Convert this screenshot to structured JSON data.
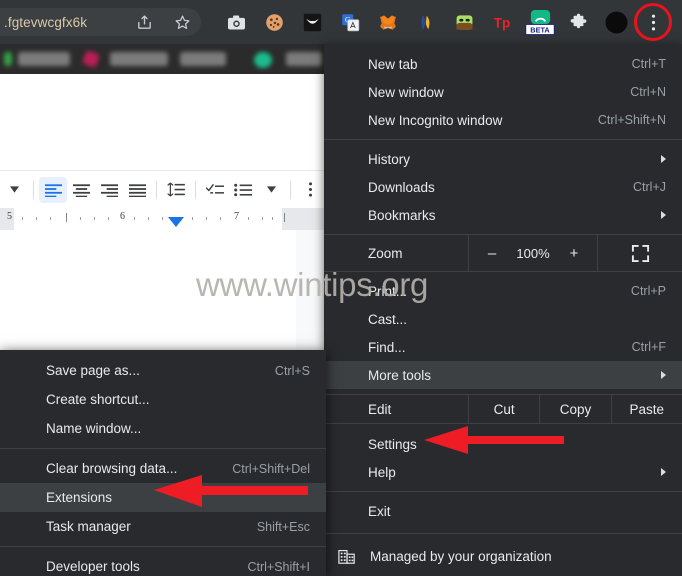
{
  "browser": {
    "omnibox_value": ".fgtevwcgfx6k",
    "toolbar_icons": [
      {
        "name": "share-icon"
      },
      {
        "name": "bookmark-star-icon"
      },
      {
        "name": "screenshot-camera-icon"
      },
      {
        "name": "cookie-icon"
      },
      {
        "name": "owl-extension-icon"
      },
      {
        "name": "google-translate-icon"
      },
      {
        "name": "metamask-fox-icon"
      },
      {
        "name": "sandbox-extension-icon"
      },
      {
        "name": "green-extension-icon"
      },
      {
        "name": "tp-extension-icon"
      },
      {
        "name": "beta-extension-icon"
      },
      {
        "name": "puzzle-extensions-icon"
      },
      {
        "name": "profile-avatar-icon"
      },
      {
        "name": "three-dot-menu-icon"
      }
    ]
  },
  "docs": {
    "toolbar_buttons": [
      {
        "name": "dropdown-caret"
      },
      {
        "name": "align-left-icon"
      },
      {
        "name": "align-center-icon"
      },
      {
        "name": "align-right-icon"
      },
      {
        "name": "align-justify-icon"
      },
      {
        "name": "line-spacing-icon"
      },
      {
        "name": "checklist-icon"
      },
      {
        "name": "bulleted-list-icon"
      },
      {
        "name": "list-dropdown-caret"
      },
      {
        "name": "more-options-icon"
      }
    ],
    "ruler_marks": [
      "5",
      "6",
      "7"
    ]
  },
  "watermark": "www.wintips.org",
  "menu": {
    "items_top": [
      {
        "label": "New tab",
        "accel": "Ctrl+T",
        "submenu": false
      },
      {
        "label": "New window",
        "accel": "Ctrl+N",
        "submenu": false
      },
      {
        "label": "New Incognito window",
        "accel": "Ctrl+Shift+N",
        "submenu": false
      }
    ],
    "items_nav": [
      {
        "label": "History",
        "accel": "",
        "submenu": true
      },
      {
        "label": "Downloads",
        "accel": "Ctrl+J",
        "submenu": false
      },
      {
        "label": "Bookmarks",
        "accel": "",
        "submenu": true
      }
    ],
    "zoom": {
      "label": "Zoom",
      "minus": "–",
      "value": "100%",
      "plus": "+",
      "fullscreen_icon": "fullscreen-icon"
    },
    "items_mid": [
      {
        "label": "Print...",
        "accel": "Ctrl+P",
        "submenu": false
      },
      {
        "label": "Cast...",
        "accel": "",
        "submenu": false
      },
      {
        "label": "Find...",
        "accel": "Ctrl+F",
        "submenu": false
      },
      {
        "label": "More tools",
        "accel": "",
        "submenu": true,
        "highlighted": true
      }
    ],
    "edit_row": {
      "label": "Edit",
      "actions": [
        "Cut",
        "Copy",
        "Paste"
      ]
    },
    "items_settings": [
      {
        "label": "Settings",
        "accel": "",
        "submenu": false
      },
      {
        "label": "Help",
        "accel": "",
        "submenu": true
      }
    ],
    "items_exit": [
      {
        "label": "Exit",
        "accel": "",
        "submenu": false
      }
    ],
    "managed": {
      "label": "Managed by your organization",
      "icon": "organization-building-icon"
    }
  },
  "submenu": {
    "group_one": [
      {
        "label": "Save page as...",
        "accel": "Ctrl+S"
      },
      {
        "label": "Create shortcut...",
        "accel": ""
      },
      {
        "label": "Name window...",
        "accel": ""
      }
    ],
    "group_two": [
      {
        "label": "Clear browsing data...",
        "accel": "Ctrl+Shift+Del",
        "highlighted": false
      },
      {
        "label": "Extensions",
        "accel": "",
        "highlighted": true
      },
      {
        "label": "Task manager",
        "accel": "Shift+Esc",
        "highlighted": false
      }
    ],
    "group_three": [
      {
        "label": "Developer tools",
        "accel": "Ctrl+Shift+I"
      }
    ]
  },
  "annotations": {
    "arrow_color": "#ee1c25",
    "circle_color": "#e8131d",
    "arrow_to_settings": "settings-arrow",
    "arrow_to_extensions": "extensions-arrow",
    "circle_on_menu_button": "three-dot-menu-highlight"
  }
}
